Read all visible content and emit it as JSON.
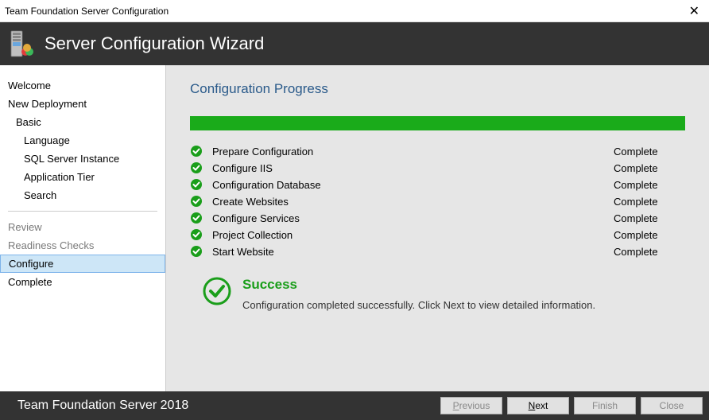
{
  "window": {
    "title": "Team Foundation Server Configuration"
  },
  "header": {
    "title": "Server Configuration Wizard"
  },
  "sidebar": {
    "items": [
      {
        "label": "Welcome",
        "indent": 0
      },
      {
        "label": "New Deployment",
        "indent": 0
      },
      {
        "label": "Basic",
        "indent": 1
      },
      {
        "label": "Language",
        "indent": 2
      },
      {
        "label": "SQL Server Instance",
        "indent": 2
      },
      {
        "label": "Application Tier",
        "indent": 2
      },
      {
        "label": "Search",
        "indent": 2
      }
    ],
    "post": [
      {
        "label": "Review",
        "dim": true
      },
      {
        "label": "Readiness Checks",
        "dim": true
      },
      {
        "label": "Configure",
        "selected": true
      },
      {
        "label": "Complete"
      }
    ]
  },
  "main": {
    "heading": "Configuration Progress",
    "steps": [
      {
        "name": "Prepare Configuration",
        "status": "Complete"
      },
      {
        "name": "Configure IIS",
        "status": "Complete"
      },
      {
        "name": "Configuration Database",
        "status": "Complete"
      },
      {
        "name": "Create Websites",
        "status": "Complete"
      },
      {
        "name": "Configure Services",
        "status": "Complete"
      },
      {
        "name": "Project Collection",
        "status": "Complete"
      },
      {
        "name": "Start Website",
        "status": "Complete"
      }
    ],
    "success": {
      "title": "Success",
      "message": "Configuration completed successfully.  Click Next to view detailed information."
    }
  },
  "footer": {
    "title": "Team Foundation Server 2018",
    "buttons": {
      "previous": "Previous",
      "next": "Next",
      "finish": "Finish",
      "close": "Close"
    }
  }
}
